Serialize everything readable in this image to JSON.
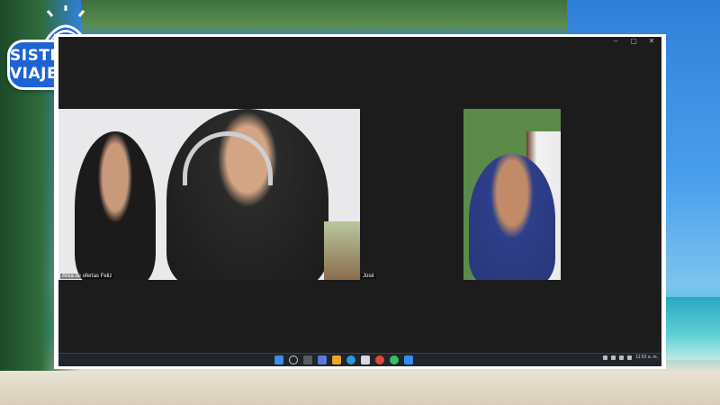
{
  "brand": {
    "name": "SISTE VIAJES"
  },
  "window": {
    "controls": [
      "–",
      "▢",
      "✕"
    ]
  },
  "participants": [
    {
      "name": "Area de ofertas Feliz"
    },
    {
      "name": "José"
    }
  ],
  "taskbar": {
    "icons": [
      "windows-start-icon",
      "search-icon",
      "task-view-icon",
      "widgets-icon",
      "files-icon",
      "edge-icon",
      "store-icon",
      "chrome-icon",
      "whatsapp-icon",
      "zoom-icon"
    ],
    "clock": {
      "time": "11:52 a. m.",
      "date": ""
    }
  },
  "colors": {
    "brand_blue": "#1e63d6",
    "window_bg": "#1c1c1c",
    "taskbar_bg": "#20242b"
  }
}
